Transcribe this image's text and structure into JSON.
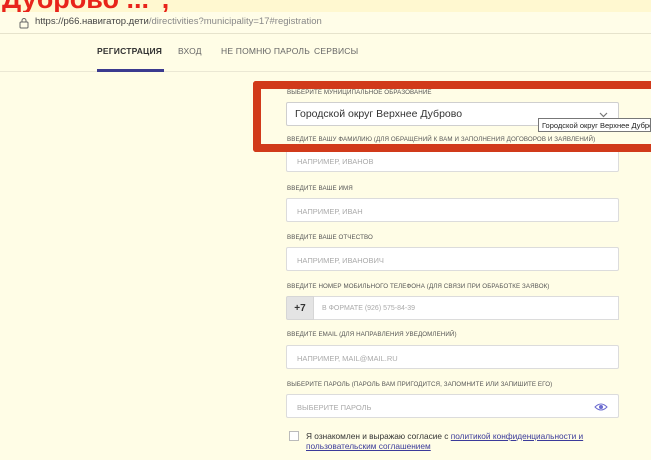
{
  "banner": {
    "text": "Дуброво ...\","
  },
  "browser": {
    "url_main": "https://р66.навигатор.дети",
    "url_rest": "/directivities?municipality=17#registration"
  },
  "tabs": [
    {
      "label": "РЕГИСТРАЦИЯ"
    },
    {
      "label": "ВХОД"
    },
    {
      "label": "НЕ ПОМНЮ ПАРОЛЬ"
    },
    {
      "label": "СЕРВИСЫ"
    }
  ],
  "form": {
    "municipality": {
      "label": "ВЫБЕРИТЕ МУНИЦИПАЛЬНОЕ ОБРАЗОВАНИЕ",
      "value": "Городской округ Верхнее Дуброво",
      "tooltip": "Городской округ Верхнее Дуброво"
    },
    "surname": {
      "label": "ВВЕДИТЕ ВАШУ ФАМИЛИЮ (ДЛЯ ОБРАЩЕНИЙ К ВАМ И ЗАПОЛНЕНИЯ ДОГОВОРОВ И ЗАЯВЛЕНИЙ)",
      "placeholder": "НАПРИМЕР, ИВАНОВ"
    },
    "name": {
      "label": "ВВЕДИТЕ ВАШЕ ИМЯ",
      "placeholder": "НАПРИМЕР, ИВАН"
    },
    "patronymic": {
      "label": "ВВЕДИТЕ ВАШЕ ОТЧЕСТВО",
      "placeholder": "НАПРИМЕР, ИВАНОВИЧ"
    },
    "phone": {
      "label": "ВВЕДИТЕ НОМЕР МОБИЛЬНОГО ТЕЛЕФОНА (ДЛЯ СВЯЗИ ПРИ ОБРАБОТКЕ ЗАЯВОК)",
      "prefix": "+7",
      "placeholder": "В ФОРМАТЕ (926) 575-84-39"
    },
    "email": {
      "label": "ВВЕДИТЕ EMAIL (ДЛЯ НАПРАВЛЕНИЯ УВЕДОМЛЕНИЙ)",
      "placeholder": "НАПРИМЕР, MAIL@MAIL.RU"
    },
    "password": {
      "label": "ВЫБЕРИТЕ ПАРОЛЬ (ПАРОЛЬ ВАМ ПРИГОДИТСЯ, ЗАПОМНИТЕ ИЛИ ЗАПИШИТЕ ЕГО)",
      "placeholder": "ВЫБЕРИТЕ ПАРОЛЬ"
    },
    "consent": {
      "text": "Я ознакомлен и выражаю согласие с ",
      "link": "политикой конфиденциальности и пользовательским соглашением"
    }
  },
  "colors": {
    "accent": "#3b3b8f",
    "highlight": "#d13a1a",
    "page_bg": "#fffde6"
  }
}
